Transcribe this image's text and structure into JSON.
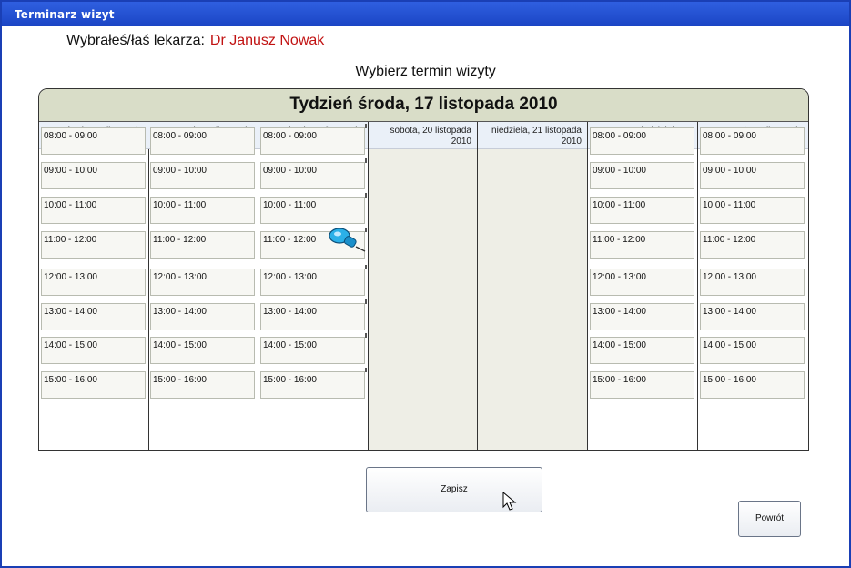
{
  "window": {
    "title": "Terminarz wizyt"
  },
  "doctor": {
    "label": "Wybrałeś/łaś lekarza:",
    "name": "Dr Janusz Nowak"
  },
  "subtitle": "Wybierz termin wizyty",
  "week_header": "Tydzień środa, 17 listopada 2010",
  "days": [
    {
      "label": "środa, 17 listopada 2010",
      "weekend": false,
      "slots": [
        "08:00 - 09:00",
        "09:00 - 10:00",
        "10:00 - 11:00",
        "11:00 - 12:00",
        "12:00 - 13:00",
        "13:00 - 14:00",
        "14:00 - 15:00",
        "15:00 - 16:00"
      ]
    },
    {
      "label": "czwartek, 18 listopada 2010",
      "weekend": false,
      "slots": [
        "08:00 - 09:00",
        "09:00 - 10:00",
        "10:00 - 11:00",
        "11:00 - 12:00",
        "12:00 - 13:00",
        "13:00 - 14:00",
        "14:00 - 15:00",
        "15:00 - 16:00"
      ]
    },
    {
      "label": "piątek, 19 listopada 2010",
      "weekend": false,
      "slots": [
        "08:00 - 09:00",
        "09:00 - 10:00",
        "10:00 - 11:00",
        "11:00 - 12:00",
        "12:00 - 13:00",
        "13:00 - 14:00",
        "14:00 - 15:00",
        "15:00 - 16:00"
      ]
    },
    {
      "label": "sobota, 20 listopada 2010",
      "weekend": true,
      "slots": []
    },
    {
      "label": "niedziela, 21 listopada 2010",
      "weekend": true,
      "slots": []
    },
    {
      "label": "poniedziałek, 22 listopada 2010",
      "weekend": false,
      "slots": [
        "08:00 - 09:00",
        "09:00 - 10:00",
        "10:00 - 11:00",
        "11:00 - 12:00",
        "12:00 - 13:00",
        "13:00 - 14:00",
        "14:00 - 15:00",
        "15:00 - 16:00"
      ]
    },
    {
      "label": "wtorek, 23 listopada 2010",
      "weekend": false,
      "slots": [
        "08:00 - 09:00",
        "09:00 - 10:00",
        "10:00 - 11:00",
        "11:00 - 12:00",
        "12:00 - 13:00",
        "13:00 - 14:00",
        "14:00 - 15:00",
        "15:00 - 16:00"
      ]
    }
  ],
  "selected": {
    "day": 2,
    "slot": 2,
    "icon": "pushpin-icon"
  },
  "buttons": {
    "save": "Zapisz",
    "back": "Powrót"
  },
  "colors": {
    "titlebar": "#2f5fe0",
    "doctor_name": "#c11212",
    "week_header_bg": "#d9ddc8",
    "weekend_bg": "#eeeee6",
    "pin": "#2bb0e8"
  }
}
